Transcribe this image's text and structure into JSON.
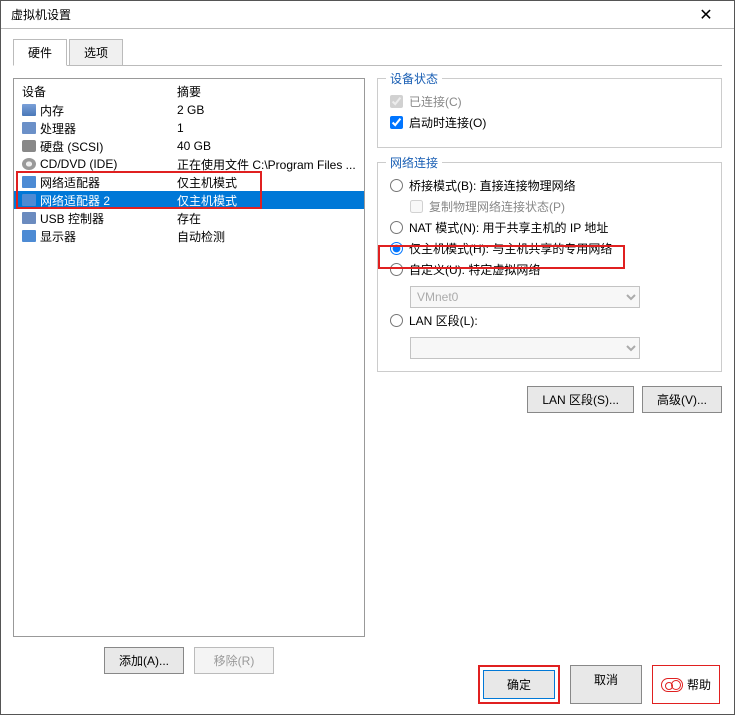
{
  "window": {
    "title": "虚拟机设置",
    "close_glyph": "✕"
  },
  "tabs": {
    "hardware": "硬件",
    "options": "选项"
  },
  "list": {
    "header_device": "设备",
    "header_summary": "摘要",
    "rows": [
      {
        "name": "内存",
        "summary": "2 GB",
        "icon": "mem"
      },
      {
        "name": "处理器",
        "summary": "1",
        "icon": "cpu"
      },
      {
        "name": "硬盘 (SCSI)",
        "summary": "40 GB",
        "icon": "disk"
      },
      {
        "name": "CD/DVD (IDE)",
        "summary": "正在使用文件 C:\\Program Files ...",
        "icon": "cd"
      },
      {
        "name": "网络适配器",
        "summary": "仅主机模式",
        "icon": "net"
      },
      {
        "name": "网络适配器 2",
        "summary": "仅主机模式",
        "icon": "net"
      },
      {
        "name": "USB 控制器",
        "summary": "存在",
        "icon": "usb"
      },
      {
        "name": "显示器",
        "summary": "自动检测",
        "icon": "disp"
      }
    ]
  },
  "left_buttons": {
    "add": "添加(A)...",
    "remove": "移除(R)"
  },
  "status_group": {
    "title": "设备状态",
    "connected": "已连接(C)",
    "connect_at_poweron": "启动时连接(O)"
  },
  "net_group": {
    "title": "网络连接",
    "bridged": "桥接模式(B): 直接连接物理网络",
    "replicate": "复制物理网络连接状态(P)",
    "nat": "NAT 模式(N): 用于共享主机的 IP 地址",
    "hostonly": "仅主机模式(H): 与主机共享的专用网络",
    "custom": "自定义(U): 特定虚拟网络",
    "custom_value": "VMnet0",
    "lan": "LAN 区段(L):",
    "lan_value": ""
  },
  "right_buttons": {
    "lan_segments": "LAN 区段(S)...",
    "advanced": "高级(V)..."
  },
  "footer": {
    "ok": "确定",
    "cancel": "取消",
    "help": "帮助"
  }
}
